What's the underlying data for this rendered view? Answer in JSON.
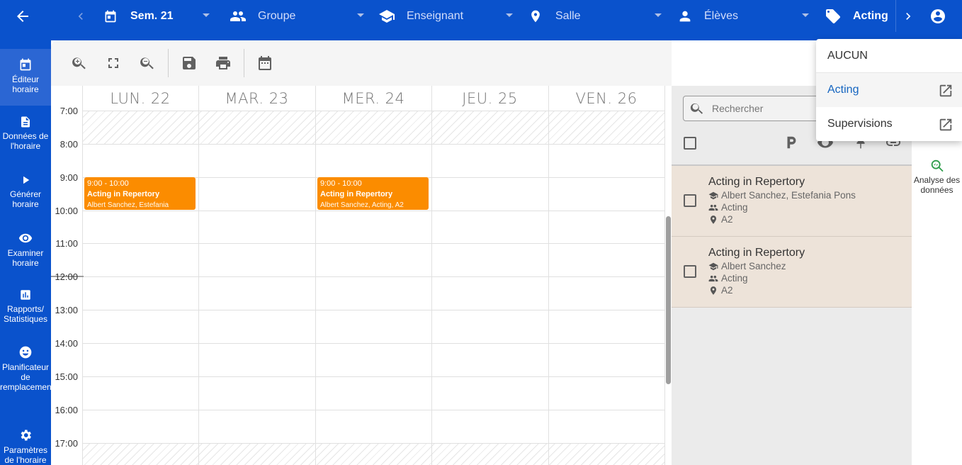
{
  "topbar": {
    "week": "Sem. 21",
    "group": "Groupe",
    "teacher": "Enseignant",
    "room": "Salle",
    "students": "Élèves",
    "tag": "Acting"
  },
  "sidebar": {
    "items": [
      {
        "label": "Éditeur horaire",
        "icon": "calendar-edit-icon"
      },
      {
        "label": "Données de l'horaire",
        "icon": "document-icon"
      },
      {
        "label": "Générer horaire",
        "icon": "play-icon"
      },
      {
        "label": "Examiner horaire",
        "icon": "eye-icon"
      },
      {
        "label": "Rapports/ Statistiques",
        "icon": "chart-icon"
      },
      {
        "label": "Planificateur de remplacement",
        "icon": "substitute-icon"
      },
      {
        "label": "Paramètres de l'horaire",
        "icon": "gear-icon"
      }
    ]
  },
  "calendar": {
    "days": [
      "LUN. 22",
      "MAR. 23",
      "MER. 24",
      "JEU. 25",
      "VEN. 26"
    ],
    "times": [
      "7:00",
      "8:00",
      "9:00",
      "10:00",
      "11:00",
      "12:00",
      "13:00",
      "14:00",
      "15:00",
      "16:00",
      "17:00"
    ],
    "events": [
      {
        "time": "9:00 - 10:00",
        "title": "Acting in Repertory",
        "detail": "Albert Sanchez, Estefania"
      },
      {
        "time": "9:00 - 10:00",
        "title": "Acting in Repertory",
        "detail": "Albert Sanchez, Acting, A2"
      }
    ]
  },
  "panel": {
    "search_placeholder": "Rechercher",
    "cards": [
      {
        "title": "Acting in Repertory",
        "teachers": "Albert Sanchez, Estefania Pons",
        "group": "Acting",
        "room": "A2"
      },
      {
        "title": "Acting in Repertory",
        "teachers": "Albert Sanchez",
        "group": "Acting",
        "room": "A2"
      }
    ]
  },
  "strip": {
    "analysis_label": "Analyse des données"
  },
  "menu": {
    "items": [
      "AUCUN",
      "Acting",
      "Supervisions"
    ]
  },
  "colors": {
    "primary": "#0a52cc",
    "event": "#fb8c00",
    "selected": "#1565c0"
  }
}
